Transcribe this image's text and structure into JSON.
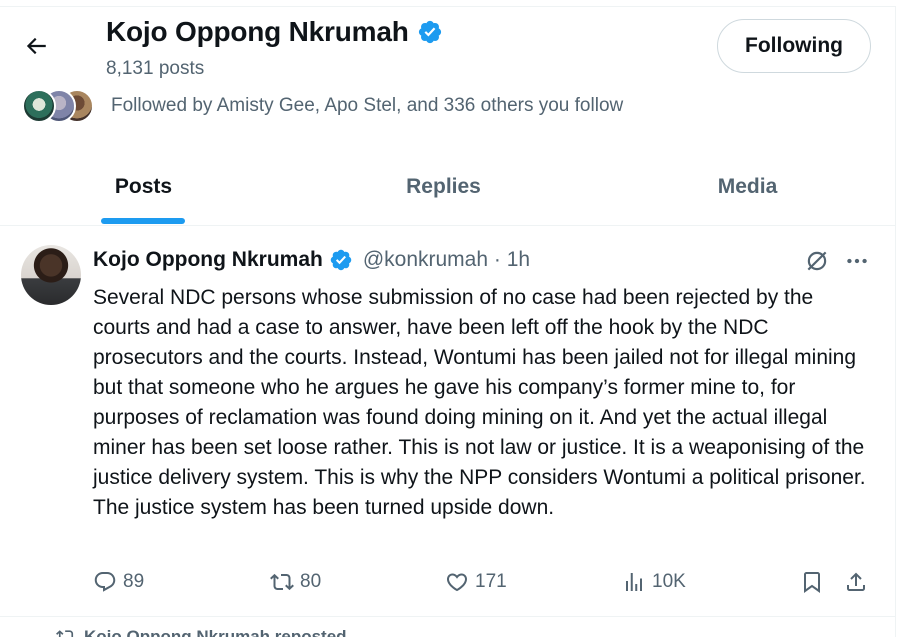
{
  "header": {
    "name": "Kojo Oppong Nkrumah",
    "post_count": "8,131 posts",
    "following_label": "Following",
    "followed_by": "Followed by Amisty Gee, Apo Stel, and 336 others you follow"
  },
  "tabs": [
    {
      "label": "Posts",
      "active": true
    },
    {
      "label": "Replies",
      "active": false
    },
    {
      "label": "Media",
      "active": false
    }
  ],
  "tweet": {
    "name": "Kojo Oppong Nkrumah",
    "handle_time": "@konkrumah · 1h",
    "text": "Several NDC persons whose submission of no case had been rejected by the courts and had a case to answer, have been left off the hook by the NDC prosecutors and the courts. Instead, Wontumi has been jailed not for illegal mining but that someone who he argues he gave his company’s former mine to, for purposes of reclamation was found doing mining on it. And yet the actual illegal miner has been set loose rather. This is not law or justice. It is a weaponising of the justice delivery system. This is why the NPP considers Wontumi a political prisoner. The justice system has been turned upside down.",
    "replies": "89",
    "reposts": "80",
    "likes": "171",
    "views": "10K"
  },
  "next": {
    "repost_label": "Kojo Oppong Nkrumah reposted"
  },
  "colors": {
    "accent": "#1d9bf0",
    "text": "#0f1419",
    "secondary": "#536471"
  },
  "icons": [
    "back-arrow-icon",
    "verified-badge-icon",
    "grok-icon",
    "more-icon",
    "reply-icon",
    "repost-icon",
    "like-icon",
    "views-icon",
    "bookmark-icon",
    "share-icon"
  ]
}
